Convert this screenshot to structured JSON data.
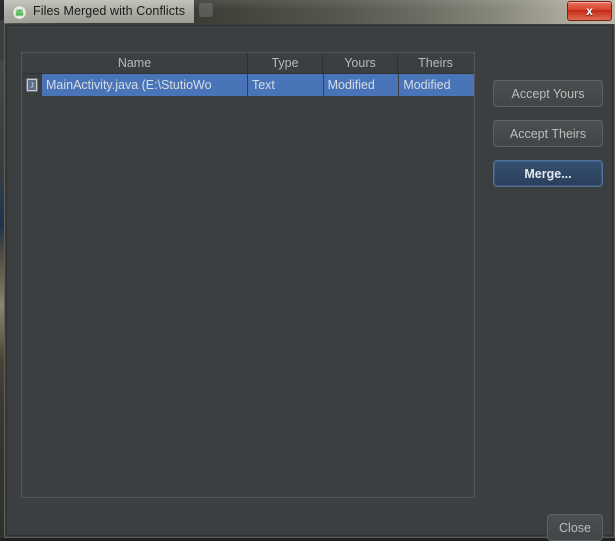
{
  "window": {
    "title": "Files Merged with Conflicts",
    "app_icon": "android-studio-icon",
    "ghost_title": "",
    "close_label": "x"
  },
  "table": {
    "columns": [
      {
        "key": "name",
        "label": "Name"
      },
      {
        "key": "type",
        "label": "Type"
      },
      {
        "key": "yours",
        "label": "Yours"
      },
      {
        "key": "theirs",
        "label": "Theirs"
      }
    ],
    "rows": [
      {
        "icon": "java-file-icon",
        "name": "MainActivity.java (E:\\StutioWo",
        "type": "Text",
        "yours": "Modified",
        "theirs": "Modified",
        "selected": true
      }
    ]
  },
  "actions": {
    "accept_yours": "Accept Yours",
    "accept_theirs": "Accept Theirs",
    "merge": "Merge...",
    "close": "Close"
  },
  "colors": {
    "selection_blue": "#4a74b8",
    "focus_button_blue": "#2b3f5c",
    "dialog_background": "#3c3f41",
    "close_button_red": "#d8412a"
  }
}
